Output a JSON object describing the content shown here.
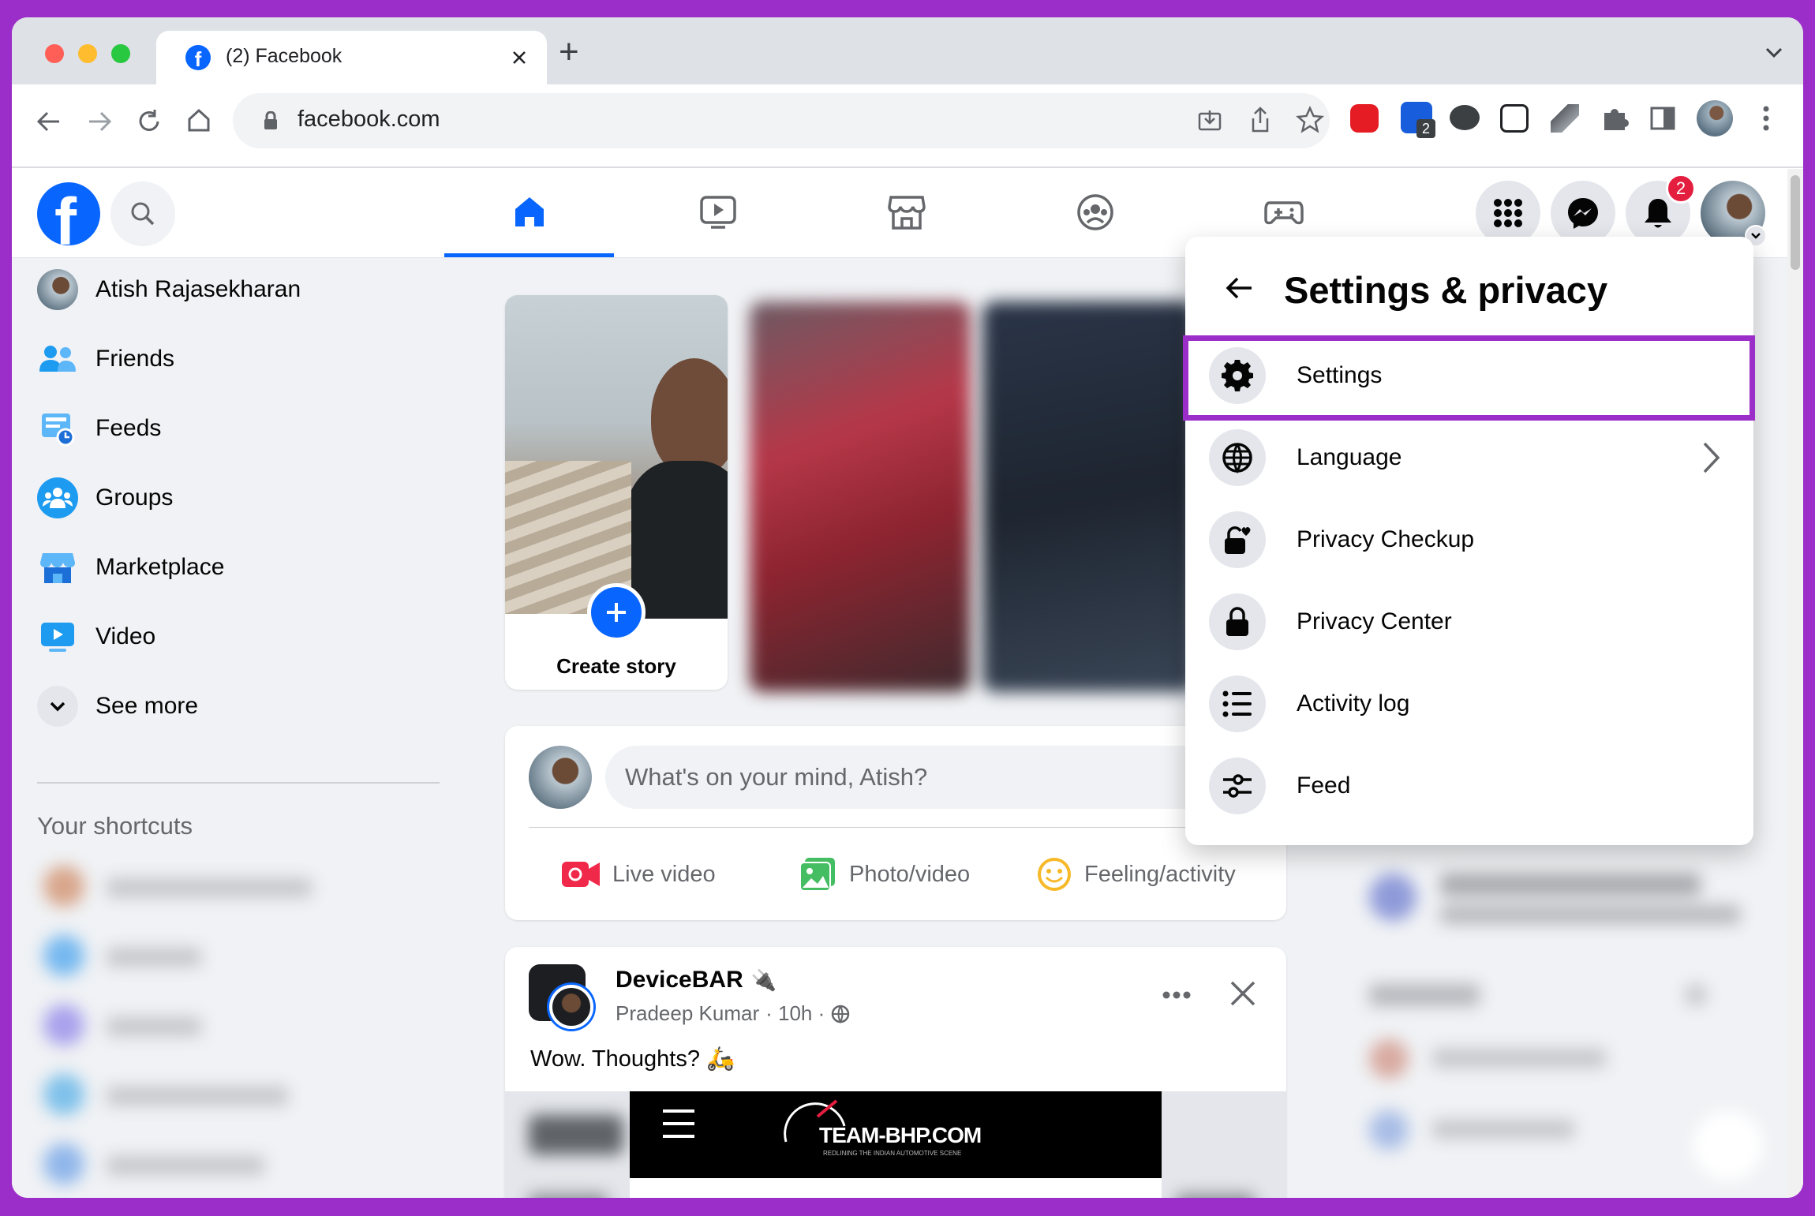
{
  "browser": {
    "tab_title": "(2) Facebook",
    "new_tab": "+",
    "address": "facebook.com",
    "ext_badge": "2"
  },
  "fb": {
    "notif_count": "2",
    "sidebar": [
      {
        "label": "Atish Rajasekharan",
        "icon": "avatar"
      },
      {
        "label": "Friends",
        "icon": "friends-icon"
      },
      {
        "label": "Feeds",
        "icon": "feeds-icon"
      },
      {
        "label": "Groups",
        "icon": "groups-icon"
      },
      {
        "label": "Marketplace",
        "icon": "marketplace-icon"
      },
      {
        "label": "Video",
        "icon": "video-icon"
      },
      {
        "label": "See more",
        "icon": "chevron-down-icon"
      }
    ],
    "shortcuts_title": "Your shortcuts",
    "create_story": "Create story",
    "composer": {
      "placeholder": "What's on your mind, Atish?",
      "live": "Live video",
      "photo": "Photo/video",
      "feeling": "Feeling/activity"
    },
    "post": {
      "page": "DeviceBAR",
      "author": "Pradeep Kumar",
      "time": "· 10h ·",
      "text": "Wow. Thoughts? 🛵",
      "image_text": "TEAM-BHP.COM",
      "image_subtext": "REDLINING THE INDIAN AUTOMOTIVE SCENE"
    },
    "menu": {
      "title": "Settings & privacy",
      "items": [
        {
          "label": "Settings",
          "icon": "gear-icon"
        },
        {
          "label": "Language",
          "icon": "globe-icon"
        },
        {
          "label": "Privacy Checkup",
          "icon": "lock-heart-icon"
        },
        {
          "label": "Privacy Center",
          "icon": "lock-icon"
        },
        {
          "label": "Activity log",
          "icon": "list-icon"
        },
        {
          "label": "Feed",
          "icon": "sliders-icon"
        }
      ]
    },
    "colors": {
      "brand": "#0866ff",
      "highlight": "#9b2ec8",
      "badge": "#e41e3f"
    }
  }
}
